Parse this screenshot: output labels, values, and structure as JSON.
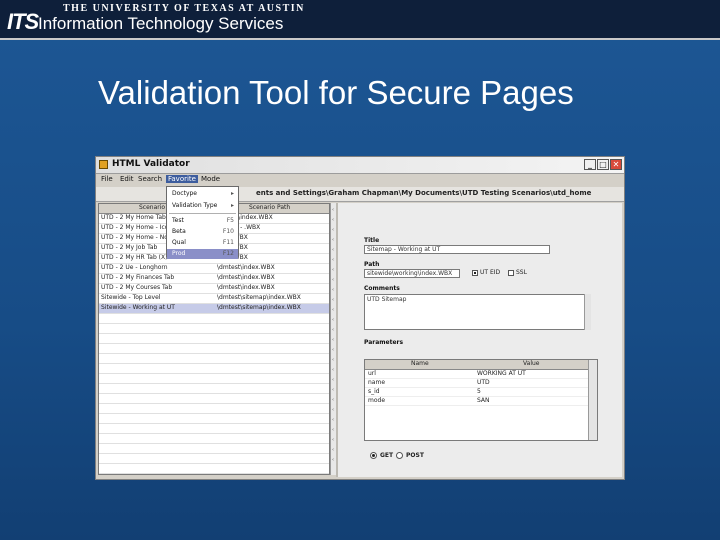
{
  "header": {
    "logo": "ITS",
    "university": "THE UNIVERSITY OF TEXAS AT AUSTIN",
    "org_name": "Information Technology Services"
  },
  "slide": {
    "title": "Validation Tool for Secure Pages"
  },
  "window": {
    "title": "HTML Validator",
    "controls": {
      "minimize": "_",
      "maximize": "□",
      "close": "✕"
    },
    "menu": [
      "File",
      "Edit",
      "Search",
      "Favorite",
      "Mode"
    ],
    "path": "ents and Settings\\Graham Chapman\\My Documents\\UTD Testing Scenarios\\utd_home"
  },
  "dropdown": {
    "items": [
      {
        "label": "Doctype",
        "shortcut": "▸"
      },
      {
        "label": "Validation Type",
        "shortcut": "▸"
      },
      {
        "label": "Test",
        "shortcut": "F5"
      },
      {
        "label": "Beta",
        "shortcut": "F10"
      },
      {
        "label": "Qual",
        "shortcut": "F11"
      },
      {
        "label": "Prod",
        "shortcut": "F12"
      }
    ],
    "highlighted_index": 5
  },
  "left_table": {
    "columns": [
      "Scenario",
      "Scenario Path"
    ],
    "rows": [
      {
        "name": "UTD - 2 My Home Tab (",
        "path": "dmtest\\index.WBX",
        "selected": false
      },
      {
        "name": "UTD - 2 My Home - Icon",
        "path": "dmtest - .WBX",
        "selected": false
      },
      {
        "name": "UTD - 2 My Home - No U",
        "path": "ndex.WBX",
        "selected": false
      },
      {
        "name": "UTD - 2 My Job Tab",
        "path": "ndex.WBX",
        "selected": false
      },
      {
        "name": "UTD - 2 My HR Tab (X)",
        "path": "ndex.WBX",
        "selected": false
      },
      {
        "name": "UTD - 2 Ue - Longhorn",
        "path": "\\dmtest\\index.WBX",
        "selected": false
      },
      {
        "name": "UTD - 2 My Finances Tab",
        "path": "\\dmtest\\index.WBX",
        "selected": false
      },
      {
        "name": "UTD - 2 My Courses Tab",
        "path": "\\dmtest\\index.WBX",
        "selected": false
      },
      {
        "name": "Sitewide - Top Level",
        "path": "\\dmtest\\sitemap\\index.WBX",
        "selected": false
      },
      {
        "name": "Sitewide - Working at UT",
        "path": "\\dmtest\\sitemap\\index.WBX",
        "selected": true
      }
    ]
  },
  "form": {
    "title_label": "Title",
    "title_value": "Sitemap - Working at UT",
    "path_label": "Path",
    "path_value": "sitewide\\working\\index.WBX",
    "ut_eid_label": "UT EID",
    "ut_eid_checked": true,
    "ssl_label": "SSL",
    "ssl_checked": false,
    "comments_label": "Comments",
    "comments_value": "UTD Sitemap",
    "params_label": "Parameters",
    "params_columns": [
      "Name",
      "Value"
    ],
    "params_rows": [
      {
        "name": "url",
        "value": "WORKING AT UT"
      },
      {
        "name": "name",
        "value": "UTD"
      },
      {
        "name": "s_id",
        "value": "5"
      },
      {
        "name": "mode",
        "value": "SAN"
      }
    ],
    "method_get": "GET",
    "method_post": "POST",
    "method_selected": "GET"
  }
}
